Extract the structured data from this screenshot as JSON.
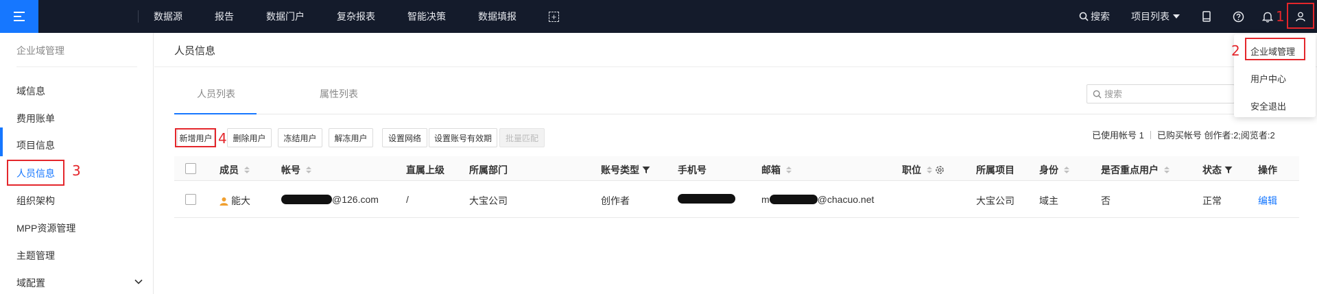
{
  "topbar": {
    "nav_items": [
      "数据源",
      "报告",
      "数据门户",
      "复杂报表",
      "智能决策",
      "数据填报"
    ],
    "search_label": "搜索",
    "project_list_label": "项目列表"
  },
  "user_menu": {
    "items": [
      "企业域管理",
      "用户中心",
      "安全退出"
    ]
  },
  "annotations": [
    "1",
    "2",
    "3",
    "4"
  ],
  "sidebar": {
    "title": "企业域管理",
    "items": [
      "域信息",
      "费用账单",
      "项目信息",
      "人员信息",
      "组织架构",
      "MPP资源管理",
      "主题管理",
      "域配置"
    ],
    "active_item": "人员信息"
  },
  "page": {
    "title": "人员信息",
    "tabs": [
      "人员列表",
      "属性列表"
    ],
    "active_tab": "人员列表",
    "search_placeholder": "搜索"
  },
  "toolbar": {
    "buttons": [
      "新增用户",
      "删除用户",
      "冻结用户",
      "解冻用户",
      "设置网络",
      "设置账号有效期",
      "批量匹配"
    ],
    "disabled_button": "批量匹配",
    "usage_used": "已使用帐号 1",
    "usage_bought": "已购买帐号 创作者:2;阅览者:2"
  },
  "table": {
    "columns": [
      "成员",
      "帐号",
      "直属上级",
      "所属部门",
      "账号类型",
      "手机号",
      "邮箱",
      "职位",
      "所属项目",
      "身份",
      "是否重点用户",
      "状态",
      "操作"
    ],
    "rows": [
      {
        "member": "能大",
        "account": "@126.com",
        "supervisor": "/",
        "department": "大宝公司",
        "account_type": "创作者",
        "phone": "",
        "email_prefix": "m",
        "email_suffix": "@chacuo.net",
        "position": "",
        "project": "大宝公司",
        "identity": "域主",
        "key_user": "否",
        "status": "正常",
        "action": "编辑"
      }
    ]
  },
  "colors": {
    "topbar_bg": "#141b2b",
    "accent": "#1677ff",
    "annotation_red": "#e4262b"
  }
}
